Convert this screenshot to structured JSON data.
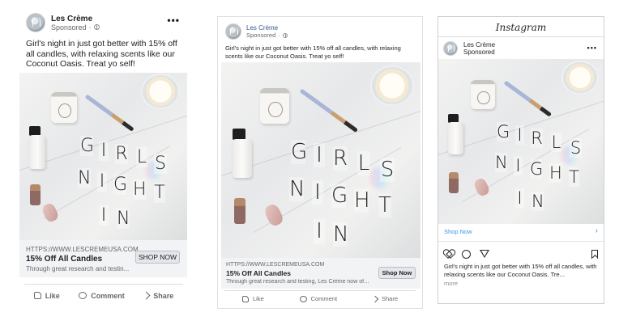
{
  "brand": {
    "page_name": "Les Crème",
    "sponsored_label": "Sponsored",
    "more_icon": "more-dots-icon",
    "globe_icon": "globe-icon"
  },
  "ad": {
    "primary_text": "Girl's night in just got better with 15% off all candles, with relaxing scents like our Coconut Oasis. Treat yo self!",
    "image_letters": [
      "G",
      "I",
      "R",
      "L",
      "S",
      "N",
      "I",
      "G",
      "H",
      "T",
      "I",
      "N"
    ]
  },
  "facebook_large": {
    "cta_url": "HTTPS://WWW.LESCREMEUSA.COM",
    "cta_title": "15% Off All Candles",
    "cta_description": "Through great research and testin...",
    "cta_button": "SHOP NOW",
    "actions": [
      {
        "label": "Like",
        "icon": "like-icon"
      },
      {
        "label": "Comment",
        "icon": "comment-icon"
      },
      {
        "label": "Share",
        "icon": "share-icon"
      }
    ]
  },
  "facebook_small": {
    "cta_url": "HTTPS://WWW.LESCREMEUSA.COM",
    "cta_title": "15% Off All Candles",
    "cta_description": "Through great research and testing, Les Crème now offe...",
    "cta_button": "Shop Now",
    "actions": [
      {
        "label": "Like",
        "icon": "like-icon"
      },
      {
        "label": "Comment",
        "icon": "comment-icon"
      },
      {
        "label": "Share",
        "icon": "share-icon"
      }
    ]
  },
  "instagram": {
    "logo": "Instagram",
    "shop_label": "Shop Now",
    "shop_chevron": "›",
    "caption": "Girl's night in just got better with 15% off all candles, with relaxing scents like our Coconut Oasis. Tre...",
    "more": "more"
  },
  "colors": {
    "facebook_text": "#1c1e21",
    "facebook_secondary": "#65676b",
    "instagram_link": "#3897f0"
  }
}
